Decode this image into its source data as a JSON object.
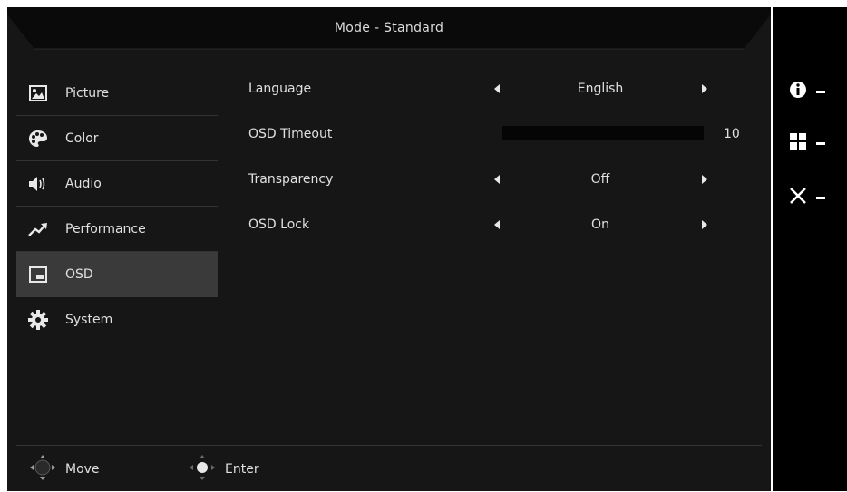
{
  "header": {
    "title": "Mode - Standard"
  },
  "sidebar": {
    "items": [
      {
        "label": "Picture",
        "icon": "picture-icon",
        "active": false
      },
      {
        "label": "Color",
        "icon": "palette-icon",
        "active": false
      },
      {
        "label": "Audio",
        "icon": "speaker-icon",
        "active": false
      },
      {
        "label": "Performance",
        "icon": "trend-icon",
        "active": false
      },
      {
        "label": "OSD",
        "icon": "osd-window-icon",
        "active": true
      },
      {
        "label": "System",
        "icon": "gear-icon",
        "active": false
      }
    ]
  },
  "settings": {
    "language": {
      "label": "Language",
      "value": "English"
    },
    "osd_timeout": {
      "label": "OSD Timeout",
      "value": "10",
      "fraction": 0
    },
    "transparency": {
      "label": "Transparency",
      "value": "Off"
    },
    "osd_lock": {
      "label": "OSD Lock",
      "value": "On"
    }
  },
  "footer": {
    "move": {
      "label": "Move",
      "icon": "dpad-move-icon"
    },
    "enter": {
      "label": "Enter",
      "icon": "dpad-enter-icon"
    }
  },
  "hotkeys": [
    "info-icon",
    "menu-grid-icon",
    "close-icon"
  ],
  "colors": {
    "background": "#161616",
    "active_item": "#3a3a3a",
    "hotkey_panel": "#000000",
    "text": "#e0e0e0"
  }
}
